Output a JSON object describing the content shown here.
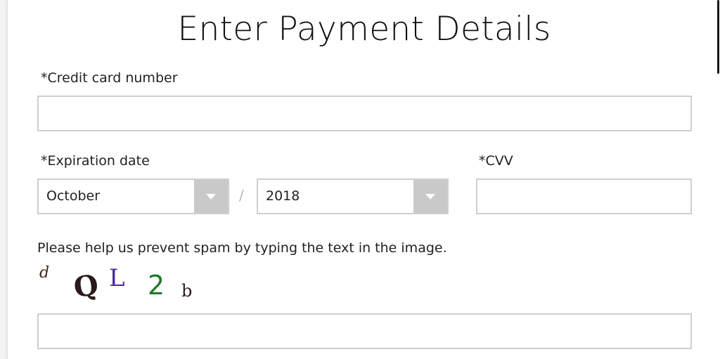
{
  "title": "Enter Payment Details",
  "card": {
    "label": "*Credit card number",
    "value": ""
  },
  "expiration": {
    "label": "*Expiration date",
    "month": "October",
    "separator": "/",
    "year": "2018"
  },
  "cvv": {
    "label": "*CVV",
    "value": ""
  },
  "captcha": {
    "prompt": "Please help us prevent spam by typing the text in the image.",
    "chars": [
      {
        "char": "d",
        "color": "#3a2a1a"
      },
      {
        "char": "Q",
        "color": "#2a1a1a"
      },
      {
        "char": "L",
        "color": "#4a2a9a"
      },
      {
        "char": "2",
        "color": "#1f7a2a"
      },
      {
        "char": "b",
        "color": "#2a1a1a"
      }
    ],
    "input_value": ""
  }
}
